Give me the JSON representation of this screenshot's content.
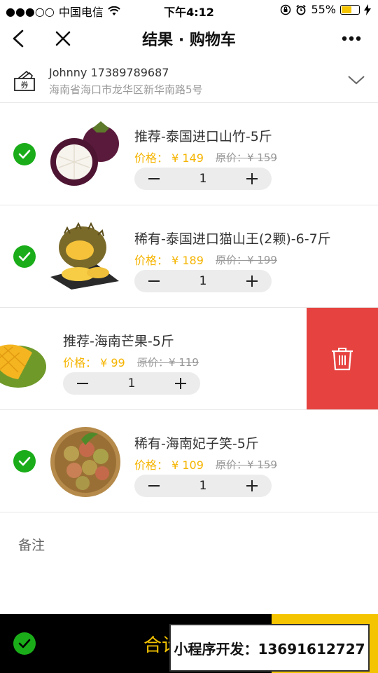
{
  "status_bar": {
    "carrier": "中国电信",
    "time": "下午4:12",
    "battery": "55%",
    "battery_level": 0.55
  },
  "nav": {
    "title": "结果 · 购物车"
  },
  "address": {
    "coupon_label": "券",
    "contact": "Johnny 17389789687",
    "detail": "海南省海口市龙华区新华南路5号"
  },
  "items": [
    {
      "name": "推荐-泰国进口山竹-5斤",
      "price_label": "价格：",
      "price": "¥ 149",
      "orig_label": "原价：",
      "orig_price": "¥ 159",
      "qty": "1",
      "checked": true,
      "image": "mangosteen-image"
    },
    {
      "name": "稀有-泰国进口猫山王(2颗)-6-7斤",
      "price_label": "价格：",
      "price": "¥ 189",
      "orig_label": "原价：",
      "orig_price": "¥ 199",
      "qty": "1",
      "checked": true,
      "image": "durian-image"
    },
    {
      "name": "推荐-海南芒果-5斤",
      "price_label": "价格：",
      "price": "¥ 99",
      "orig_label": "原价：",
      "orig_price": "¥ 119",
      "qty": "1",
      "checked": true,
      "swiped": true,
      "image": "mango-image"
    },
    {
      "name": "稀有-海南妃子笑-5斤",
      "price_label": "价格：",
      "price": "¥ 109",
      "orig_label": "原价：",
      "orig_price": "¥ 159",
      "qty": "1",
      "checked": true,
      "image": "lychee-image"
    }
  ],
  "remark": {
    "label": "备注"
  },
  "bottom": {
    "total_label": "合计",
    "watermark": "小程序开发：13691612727"
  },
  "colors": {
    "accent": "#f5b400",
    "check": "#1aad19",
    "delete": "#e64340"
  }
}
